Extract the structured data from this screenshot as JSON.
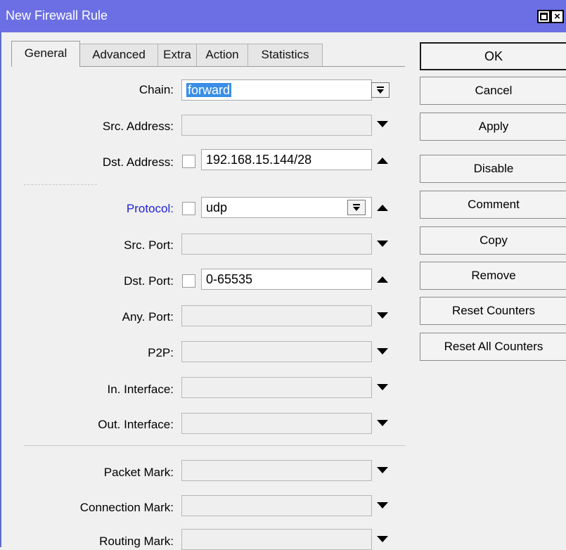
{
  "window": {
    "title": "New Firewall Rule"
  },
  "tabs": [
    "General",
    "Advanced",
    "Extra",
    "Action",
    "Statistics"
  ],
  "form": {
    "chain": {
      "label": "Chain:",
      "value": "forward"
    },
    "src_address": {
      "label": "Src. Address:",
      "value": ""
    },
    "dst_address": {
      "label": "Dst. Address:",
      "value": "192.168.15.144/28"
    },
    "protocol": {
      "label": "Protocol:",
      "value": "udp",
      "label_color": "#2020d8"
    },
    "src_port": {
      "label": "Src. Port:",
      "value": ""
    },
    "dst_port": {
      "label": "Dst. Port:",
      "value": "0-65535"
    },
    "any_port": {
      "label": "Any. Port:",
      "value": ""
    },
    "p2p": {
      "label": "P2P:",
      "value": ""
    },
    "in_interface": {
      "label": "In. Interface:",
      "value": ""
    },
    "out_interface": {
      "label": "Out. Interface:",
      "value": ""
    },
    "packet_mark": {
      "label": "Packet Mark:",
      "value": ""
    },
    "connection_mark": {
      "label": "Connection Mark:",
      "value": ""
    },
    "routing_mark": {
      "label": "Routing Mark:",
      "value": ""
    }
  },
  "buttons": {
    "ok": "OK",
    "cancel": "Cancel",
    "apply": "Apply",
    "disable": "Disable",
    "comment": "Comment",
    "copy": "Copy",
    "remove": "Remove",
    "reset_counters": "Reset Counters",
    "reset_all_counters": "Reset All Counters"
  },
  "colors": {
    "title_bar": "#6b6fe3",
    "selection": "#3a8ee6"
  }
}
